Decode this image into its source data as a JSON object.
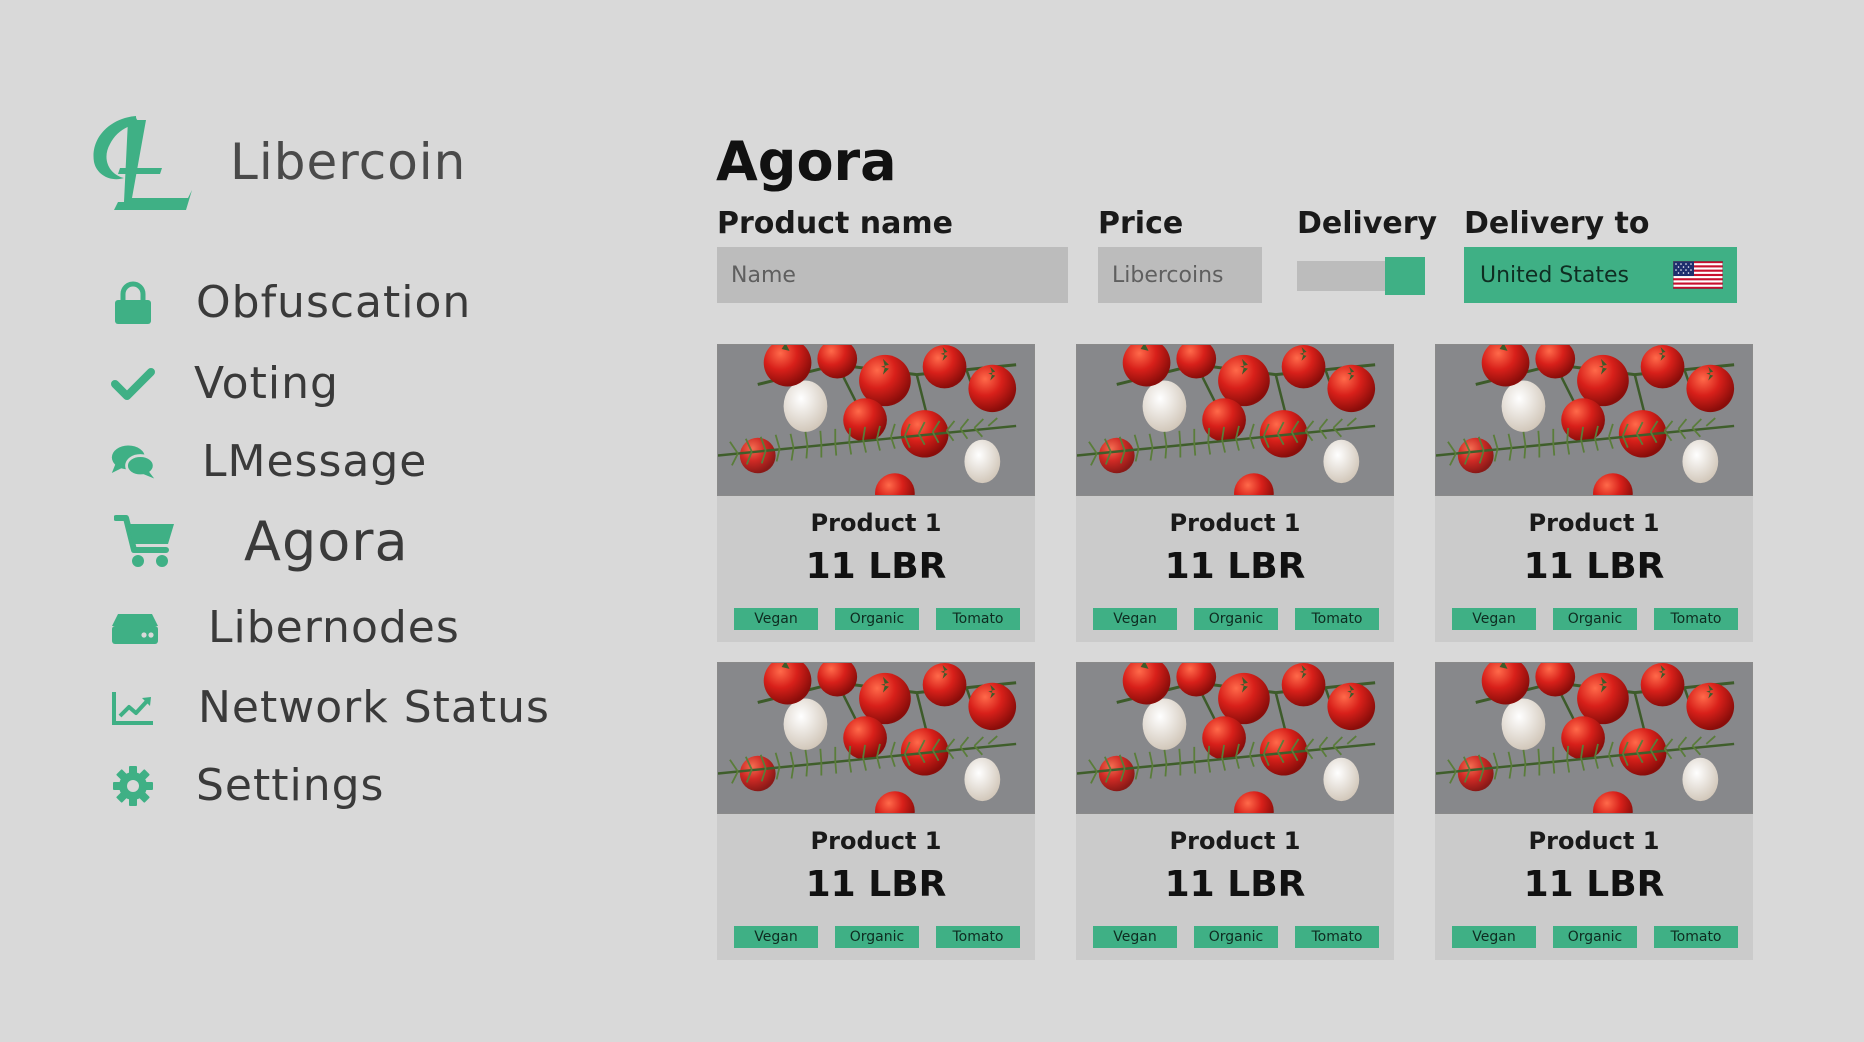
{
  "brand": {
    "name": "Libercoin",
    "accent_color": "#3fb085",
    "logo_icon": "libercoin-logo-icon"
  },
  "sidebar": {
    "items": [
      {
        "label": "Obfuscation",
        "icon": "lock-icon"
      },
      {
        "label": "Voting",
        "icon": "check-icon"
      },
      {
        "label": "LMessage",
        "icon": "chat-bubbles-icon"
      },
      {
        "label": "Agora",
        "icon": "cart-icon",
        "active": true
      },
      {
        "label": "Libernodes",
        "icon": "server-icon"
      },
      {
        "label": "Network Status",
        "icon": "line-chart-icon"
      },
      {
        "label": "Settings",
        "icon": "gear-icon"
      }
    ]
  },
  "main": {
    "title": "Agora",
    "filters": {
      "product_name_label": "Product name",
      "product_name_placeholder": "Name",
      "price_label": "Price",
      "price_placeholder": "Libercoins",
      "delivery_label": "Delivery",
      "delivery_enabled": true,
      "delivery_to_label": "Delivery to",
      "delivery_to_value": "United States",
      "delivery_to_icon": "us-flag-icon"
    },
    "products": [
      {
        "name": "Product 1",
        "price": "11 LBR",
        "tags": [
          "Vegan",
          "Organic",
          "Tomato"
        ],
        "image": "tomatoes-garlic-rosemary-photo"
      },
      {
        "name": "Product 1",
        "price": "11 LBR",
        "tags": [
          "Vegan",
          "Organic",
          "Tomato"
        ],
        "image": "tomatoes-garlic-rosemary-photo"
      },
      {
        "name": "Product 1",
        "price": "11 LBR",
        "tags": [
          "Vegan",
          "Organic",
          "Tomato"
        ],
        "image": "tomatoes-garlic-rosemary-photo"
      },
      {
        "name": "Product 1",
        "price": "11 LBR",
        "tags": [
          "Vegan",
          "Organic",
          "Tomato"
        ],
        "image": "tomatoes-garlic-rosemary-photo"
      },
      {
        "name": "Product 1",
        "price": "11 LBR",
        "tags": [
          "Vegan",
          "Organic",
          "Tomato"
        ],
        "image": "tomatoes-garlic-rosemary-photo"
      },
      {
        "name": "Product 1",
        "price": "11 LBR",
        "tags": [
          "Vegan",
          "Organic",
          "Tomato"
        ],
        "image": "tomatoes-garlic-rosemary-photo"
      }
    ]
  },
  "colors": {
    "background": "#d9d9d9",
    "accent": "#3fb085",
    "input_bg": "#bcbcbc",
    "card_bg": "#cbcbcb"
  }
}
